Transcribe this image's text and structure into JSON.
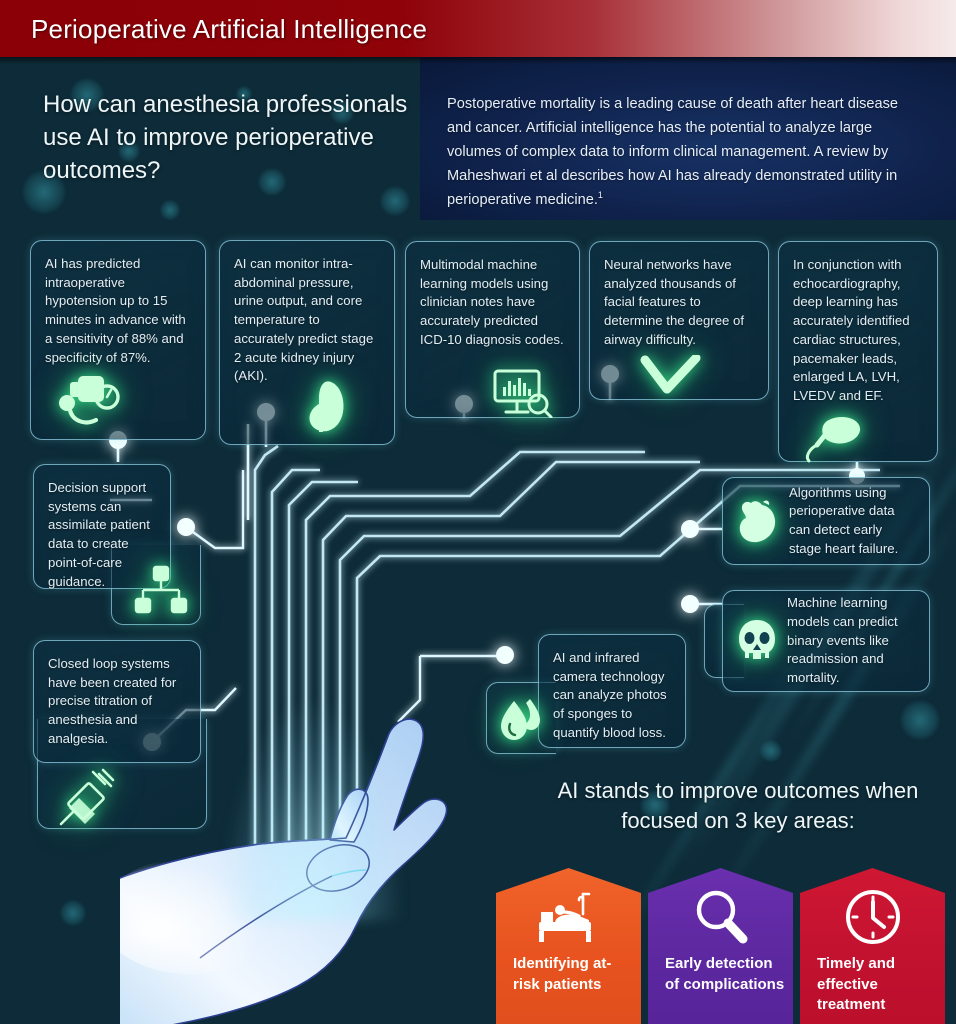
{
  "header": {
    "title": "Perioperative Artificial Intelligence",
    "bar_color": "#8a0006"
  },
  "intro": {
    "question": "How can anesthesia professionals use AI to improve perioperative outcomes?",
    "body": "Postoperative mortality is a leading cause of death after heart disease and cancer. Artificial intelligence has the potential to analyze large volumes of complex data to inform clinical management. A review by Maheshwari et al describes how AI has already demonstrated utility in perioperative medicine.",
    "reference_marker": "1"
  },
  "cards": [
    {
      "id": "hypotension",
      "text": "AI has predicted intraoperative hypotension up to 15 minutes in advance with a sensitivity of 88% and specificity of 87%.",
      "icon": "blood-pressure-cuff-icon"
    },
    {
      "id": "aki",
      "text": "AI can monitor intra-abdominal pressure, urine output, and core temperature to accurately predict stage 2 acute kidney injury (AKI).",
      "icon": "kidney-icon"
    },
    {
      "id": "icd",
      "text": "Multimodal machine learning models using clinician notes have accurately predicted ICD-10 diagnosis codes.",
      "icon": "monitor-chart-search-icon"
    },
    {
      "id": "airway",
      "text": "Neural networks have analyzed thousands of facial features to determine the degree of airway difficulty.",
      "icon": "checkmark-airway-icon"
    },
    {
      "id": "echo",
      "text": "In conjunction with echocardiography, deep learning has accurately identified cardiac structures, pacemaker leads, enlarged LA, LVH, LVEDV and EF.",
      "icon": "ultrasound-probe-icon"
    },
    {
      "id": "decision",
      "text": "Decision support systems can assimilate patient data to create point-of-care guidance.",
      "icon": "hierarchy-tree-icon"
    },
    {
      "id": "closedloop",
      "text": "Closed loop systems have been created for precise titration of anesthesia and analgesia.",
      "icon": "syringe-icon"
    },
    {
      "id": "heartfail",
      "text": "Algorithms using perioperative data can detect early stage heart failure.",
      "icon": "heart-anatomical-icon"
    },
    {
      "id": "mlbinary",
      "text": "Machine learning models can predict binary events like readmission and mortality.",
      "icon": "skull-icon"
    },
    {
      "id": "infrared",
      "text": "AI and infrared camera technology can analyze photos of sponges to quantify blood loss.",
      "icon": "blood-drops-icon"
    }
  ],
  "cta": {
    "heading": "AI stands to improve outcomes when focused on 3 key areas:",
    "areas": [
      {
        "label": "Identifying at-risk patients",
        "icon": "hospital-bed-patient-icon",
        "color": "#e8531f"
      },
      {
        "label": "Early detection of complications",
        "icon": "magnifier-icon",
        "color": "#5d28a0"
      },
      {
        "label": "Timely and effective treatment",
        "icon": "clock-icon",
        "color": "#c21230"
      }
    ]
  },
  "illustration": {
    "hand": "open-palm-hand-illustration",
    "circuit": "circuit-trace-network"
  }
}
